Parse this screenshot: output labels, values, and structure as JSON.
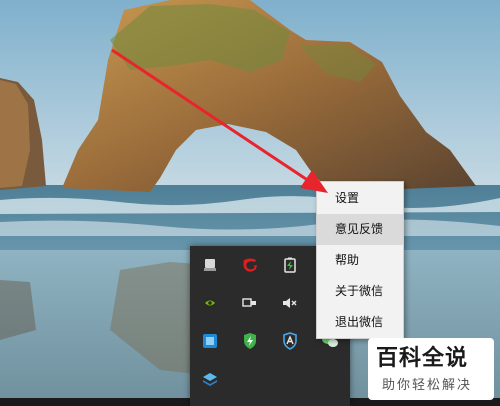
{
  "context_menu": {
    "items": [
      {
        "label": "设置",
        "hover": false
      },
      {
        "label": "意见反馈",
        "hover": true
      },
      {
        "label": "帮助",
        "hover": false
      },
      {
        "label": "关于微信",
        "hover": false
      },
      {
        "label": "退出微信",
        "hover": false
      }
    ]
  },
  "tray_icons": [
    {
      "name": "usb-drive-icon",
      "interactable": true
    },
    {
      "name": "netease-red-icon",
      "interactable": true
    },
    {
      "name": "battery-charging-icon",
      "interactable": true
    },
    {
      "name": "nvidia-icon",
      "interactable": true
    },
    {
      "name": "network-icon",
      "interactable": true
    },
    {
      "name": "volume-muted-icon",
      "interactable": true
    },
    {
      "name": "blue-app-icon",
      "interactable": true
    },
    {
      "name": "security-shield-icon",
      "interactable": true
    },
    {
      "name": "defender-shield-icon",
      "interactable": true
    },
    {
      "name": "wechat-icon",
      "interactable": true
    },
    {
      "name": "layers-app-icon",
      "interactable": true
    }
  ],
  "watermark": {
    "title": "百科全说",
    "subtitle": "助你轻松解决"
  },
  "colors": {
    "arrow": "#e8242c",
    "menu_bg": "#f2f2f2",
    "menu_hover": "#dadada",
    "tray_bg": "#2b2b2b"
  }
}
